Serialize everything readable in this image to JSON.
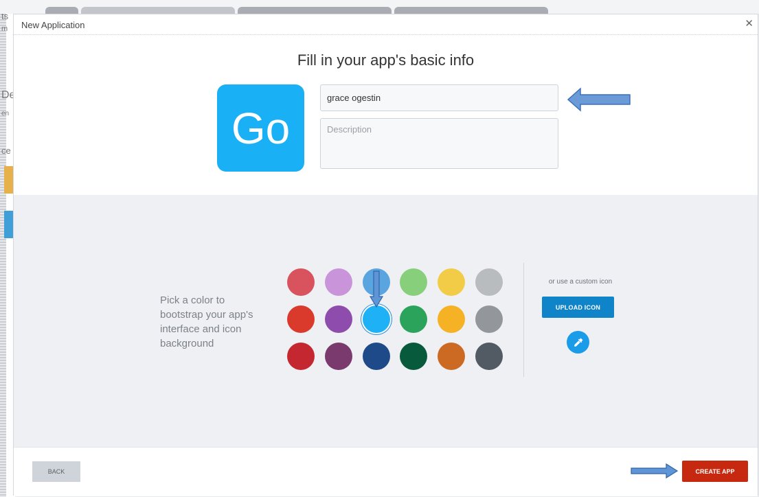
{
  "modal": {
    "title": "New Application",
    "close_icon": "close-icon",
    "heading": "Fill in your app's basic info"
  },
  "app_icon": {
    "text": "Go",
    "color": "#1ab0f5"
  },
  "form": {
    "name_value": "grace ogestin",
    "description_placeholder": "Description"
  },
  "color_picker": {
    "prompt": "Pick a color to bootstrap your app's interface and icon background",
    "colors": [
      "#d9535e",
      "#c994d9",
      "#5aa5e0",
      "#88cf7c",
      "#f2cc47",
      "#b9bcbf",
      "#d93a2b",
      "#8e4cad",
      "#1fb1f5",
      "#2ba35b",
      "#f5b224",
      "#93979c",
      "#c4272f",
      "#7a3a6e",
      "#1f4a8a",
      "#075a3c",
      "#cc6a24",
      "#525b64"
    ],
    "selected_index": 8
  },
  "custom_icon": {
    "label": "or use a custom icon",
    "upload_label": "UPLOAD ICON",
    "eyedropper_icon": "eyedropper-icon"
  },
  "footer": {
    "back_label": "BACK",
    "create_label": "CREATE APP"
  },
  "background_fragments": {
    "items": [
      "ts",
      "m",
      "De",
      "en",
      "ce"
    ]
  }
}
